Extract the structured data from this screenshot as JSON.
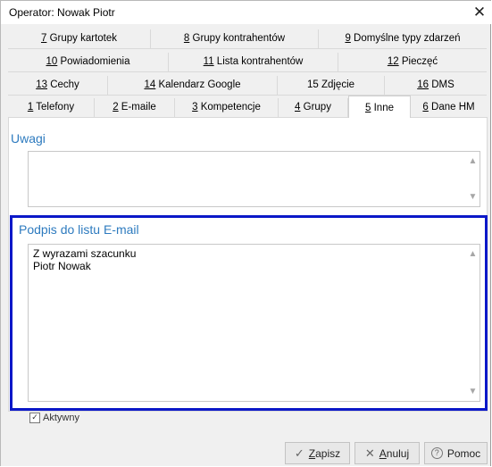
{
  "window": {
    "title": "Operator: Nowak Piotr",
    "close_glyph": "✕"
  },
  "tabs": {
    "row1": [
      {
        "key": "7",
        "rest": " Grupy kartotek"
      },
      {
        "key": "8",
        "rest": " Grupy kontrahentów"
      },
      {
        "key": "9",
        "rest": " Domyślne typy zdarzeń"
      }
    ],
    "row2": [
      {
        "key": "10",
        "rest": " Powiadomienia"
      },
      {
        "key": "11",
        "rest": " Lista kontrahentów"
      },
      {
        "key": "12",
        "rest": " Pieczęć"
      }
    ],
    "row3": [
      {
        "key": "13",
        "rest": " Cechy"
      },
      {
        "key": "14",
        "rest": " Kalendarz Google"
      },
      {
        "key": "",
        "rest": "15 Zdjęcie"
      },
      {
        "key": "16",
        "rest": " DMS"
      }
    ],
    "row4": [
      {
        "key": "1",
        "rest": " Telefony"
      },
      {
        "key": "2",
        "rest": " E-maile"
      },
      {
        "key": "3",
        "rest": " Kompetencje"
      },
      {
        "key": "4",
        "rest": " Grupy"
      },
      {
        "key": "5",
        "rest": " Inne"
      },
      {
        "key": "6",
        "rest": " Dane HM"
      }
    ],
    "active": "5 Inne"
  },
  "notes": {
    "label": "Uwagi",
    "value": ""
  },
  "signature": {
    "label": "Podpis do listu E-mail",
    "value": "Z wyrazami szacunku\nPiotr Nowak"
  },
  "active_checkbox": {
    "label": "Aktywny",
    "checked": true,
    "glyph": "✓"
  },
  "buttons": {
    "save": {
      "icon": "✓",
      "key": "Z",
      "rest": "apisz"
    },
    "cancel": {
      "icon": "✕",
      "key": "A",
      "rest": "nuluj"
    },
    "help": {
      "icon": "?",
      "label": "Pomoc"
    }
  },
  "scroll": {
    "up": "▲",
    "down": "▼"
  }
}
